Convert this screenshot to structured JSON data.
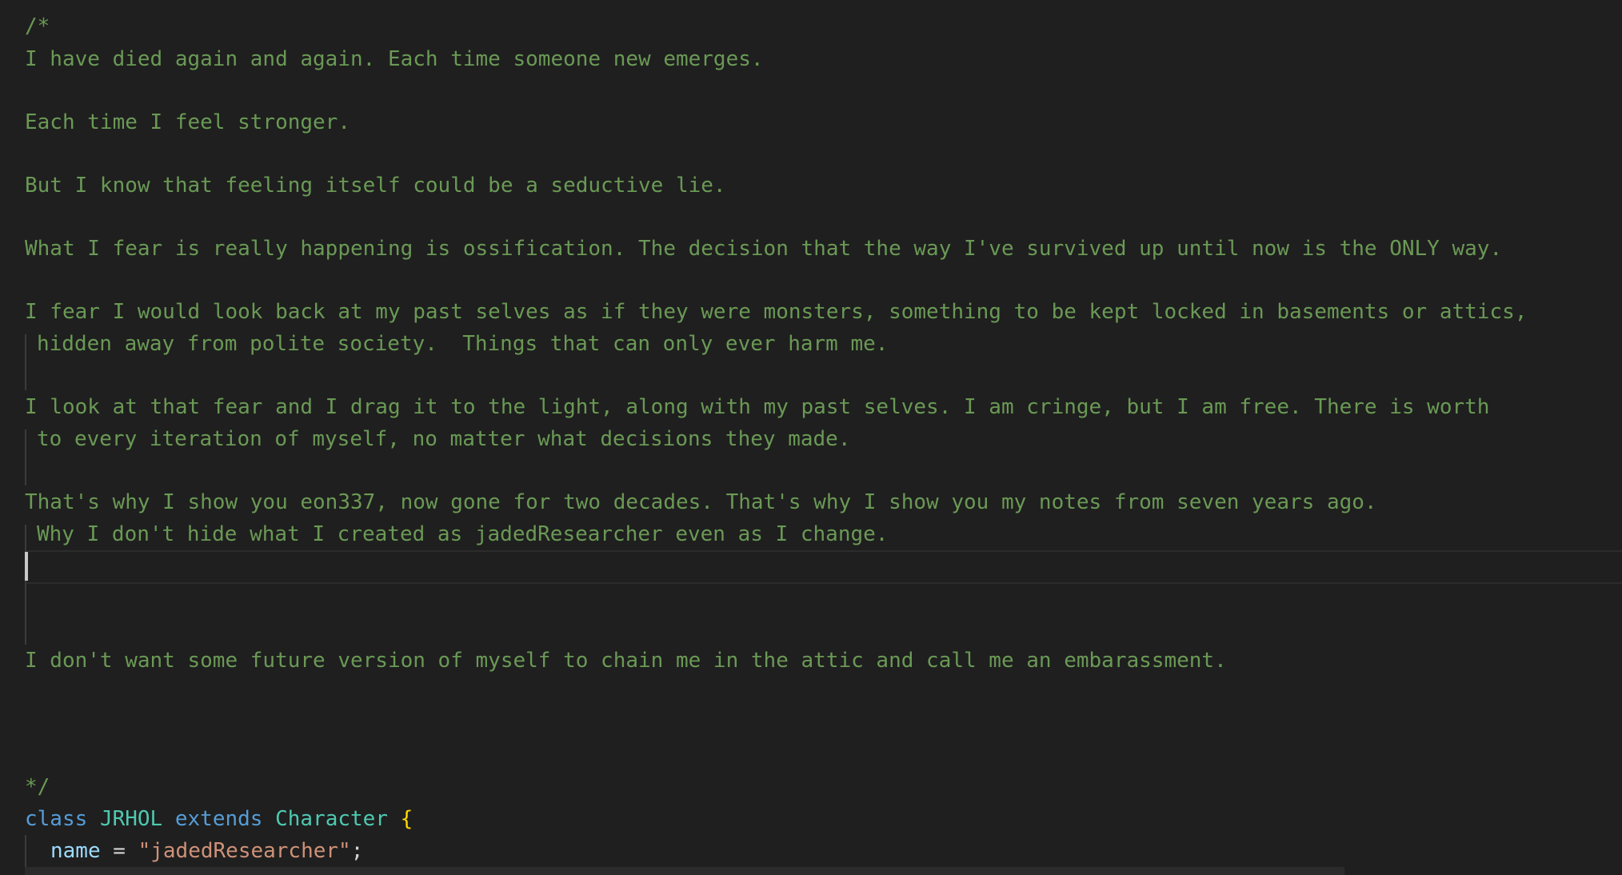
{
  "editor": {
    "comment_lines": [
      "/*",
      "I have died again and again. Each time someone new emerges.",
      "Each time I feel stronger.",
      "But I know that feeling itself could be a seductive lie.",
      "What I fear is really happening is ossification. The decision that the way I've survived up until now is the ONLY way.",
      "I fear I would look back at my past selves as if they were monsters, something to be kept locked in basements or attics,",
      "hidden away from polite society.  Things that can only ever harm me.",
      "I look at that fear and I drag it to the light, along with my past selves. I am cringe, but I am free. There is worth",
      "to every iteration of myself, no matter what decisions they made.",
      "That's why I show you eon337, now gone for two decades. That's why I show you my notes from seven years ago.",
      "Why I don't hide what I created as jadedResearcher even as I change.",
      "I don't want some future version of myself to chain me in the attic and call me an embarassment.",
      "*/"
    ],
    "code": {
      "keyword_class": "class",
      "class_name": "JRHOL",
      "keyword_extends": "extends",
      "parent_class": "Character",
      "open_brace": "{",
      "property_name": "name",
      "assign": " = ",
      "property_value": "\"jadedResearcher\"",
      "semicolon": ";"
    },
    "colors": {
      "background": "#1f1f1f",
      "comment": "#6a9955",
      "keyword": "#569cd6",
      "type": "#4ec9b0",
      "brace": "#ffd700",
      "property": "#9cdcfe",
      "string": "#ce9178",
      "text": "#d4d4d4"
    }
  }
}
